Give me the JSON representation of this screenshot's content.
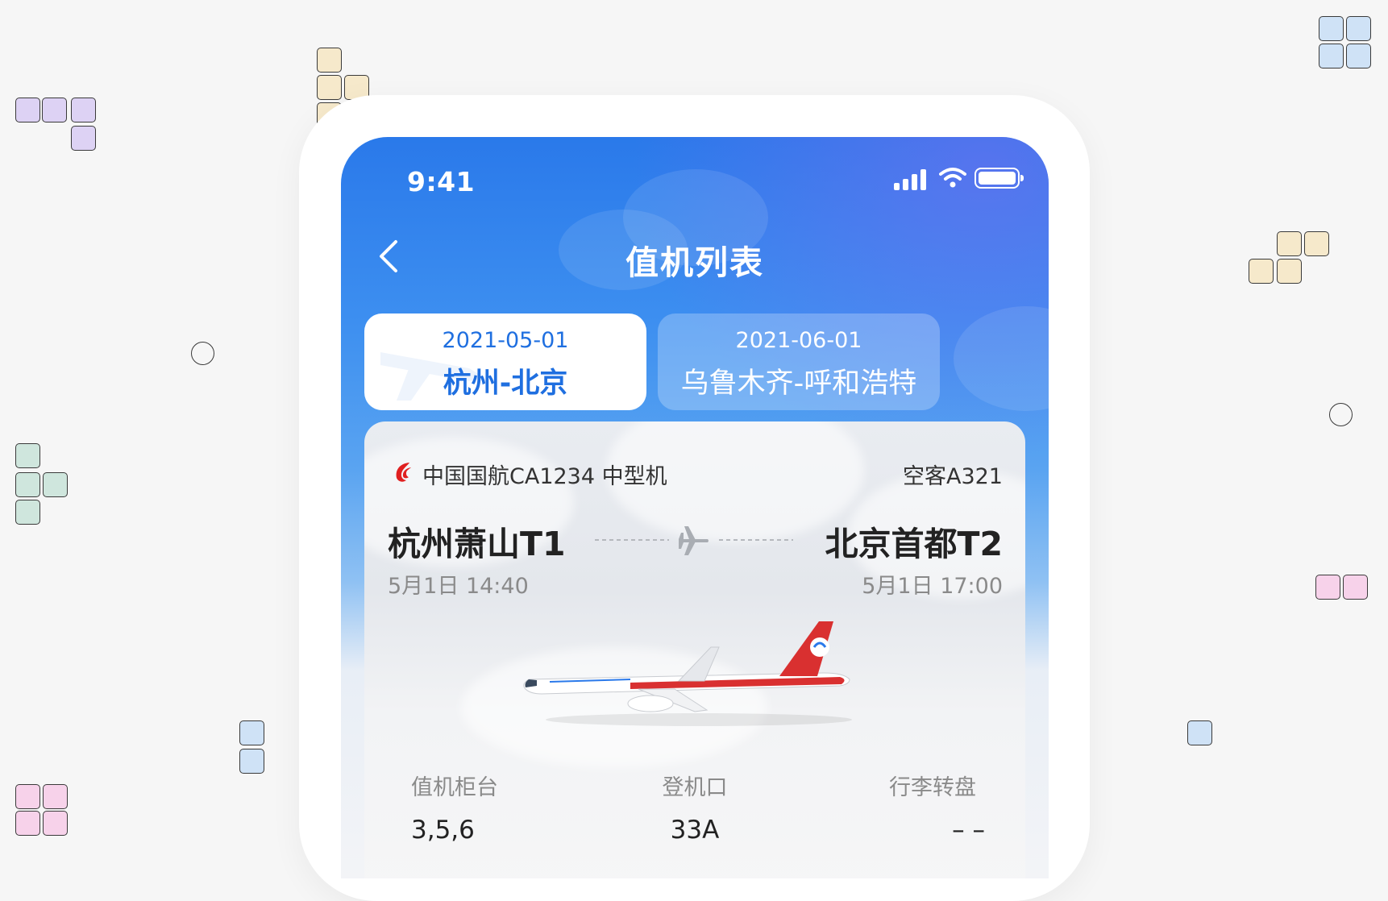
{
  "status_bar": {
    "time": "9:41"
  },
  "nav": {
    "title": "值机列表"
  },
  "tabs": [
    {
      "date": "2021-05-01",
      "route": "杭州-北京",
      "active": true
    },
    {
      "date": "2021-06-01",
      "route": "乌鲁木齐-呼和浩特",
      "active": false
    }
  ],
  "flight": {
    "airline": "中国国航CA1234  中型机",
    "aircraft": "空客A321",
    "departure": {
      "airport": "杭州萧山T1",
      "time": "5月1日 14:40"
    },
    "arrival": {
      "airport": "北京首都T2",
      "time": "5月1日 17:00"
    },
    "info": [
      {
        "label": "值机柜台",
        "value": "3,5,6"
      },
      {
        "label": "登机口",
        "value": "33A"
      },
      {
        "label": "行李转盘",
        "value": "– –"
      }
    ]
  },
  "colors": {
    "accent": "#1f6fe0",
    "header_gradient_top": "#2a79ea",
    "background": "#f6f6f6",
    "airline_red": "#e02020"
  },
  "icons": [
    "back-chevron-icon",
    "signal-icon",
    "wifi-icon",
    "battery-icon",
    "airplane-icon",
    "air-china-logo-icon"
  ]
}
